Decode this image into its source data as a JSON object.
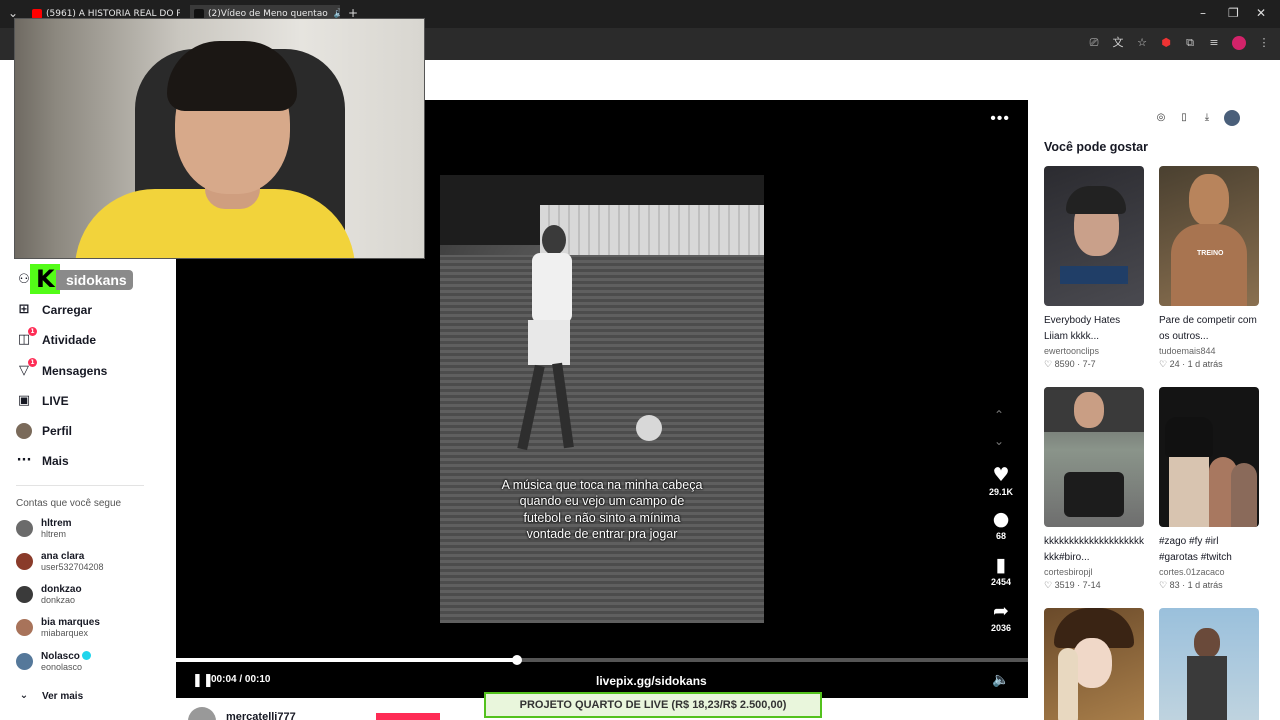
{
  "browser": {
    "tabs": [
      {
        "title": "(5961) A HISTORIA REAL DO P...",
        "favicon_color": "#ff0000"
      },
      {
        "title": "(2)Vídeo de Meno quentao",
        "favicon_color": "#111111"
      }
    ],
    "new_tab_symbol": "+",
    "window_controls": [
      "–",
      "❐",
      "✕"
    ]
  },
  "streamer_overlay": {
    "kick_logo_letter": "K",
    "kick_handle": "sidokans"
  },
  "sidebar": {
    "items": [
      {
        "label": "Carregar",
        "icon": "plus-square-icon",
        "glyph": "⊞"
      },
      {
        "label": "Atividade",
        "icon": "activity-icon",
        "glyph": "◫",
        "badge": "1"
      },
      {
        "label": "Mensagens",
        "icon": "messages-icon",
        "glyph": "▽",
        "badge": "1"
      },
      {
        "label": "LIVE",
        "icon": "live-icon",
        "glyph": "▣"
      },
      {
        "label": "Perfil",
        "icon": "profile-avatar",
        "glyph": ""
      },
      {
        "label": "Mais",
        "icon": "more-icon",
        "glyph": "···"
      }
    ],
    "following_heading": "Contas que você segue",
    "following": [
      {
        "name": "hltrem",
        "handle": "hltrem",
        "color": "#6b6b6b"
      },
      {
        "name": "ana clara",
        "handle": "user532704208",
        "color": "#8a3b2a"
      },
      {
        "name": "donkzao",
        "handle": "donkzao",
        "color": "#3a3a3a"
      },
      {
        "name": "bia marques",
        "handle": "miabarquex",
        "color": "#a8735a"
      },
      {
        "name": "Nolasco",
        "handle": "eonolasco",
        "color": "#55789a",
        "verified": true
      }
    ],
    "see_more": "Ver mais"
  },
  "player": {
    "more_glyph": "•••",
    "caption": "A música que toca na minha cabeça quando eu vejo um campo de futebol e não sinto a mínima vontade de entrar pra jogar",
    "likes": "29.1K",
    "comments": "68",
    "saves": "2454",
    "shares": "2036",
    "current_time": "00:04",
    "duration": "00:10",
    "time_display": "00:04 / 00:10",
    "progress_fraction": 0.4,
    "overlay_link": "livepix.gg/sidokans",
    "project_bar": "PROJETO QUARTO DE LIVE (R$ 18,23/R$ 2.500,00)",
    "comment_author": "mercatelli777"
  },
  "recommendations": {
    "title": "Você pode gostar",
    "items": [
      {
        "title": "Everybody Hates Liiam kkkk...",
        "author": "ewertoonclips",
        "likes": "8590",
        "date": "7-7",
        "bg": "#3b3a3c",
        "accent": "#2c5fa8"
      },
      {
        "title": "Pare de competir com os outros...",
        "author": "tudoemais844",
        "likes": "24",
        "date": "1 d atrás",
        "bg": "#7a6a4a",
        "accent": "#c8a070"
      },
      {
        "title": "kkkkkkkkkkkkkkkkkkkkkkk#biro...",
        "author": "cortesbiropjl",
        "likes": "3519",
        "date": "7-14",
        "bg": "#6e7a6a",
        "accent": "#2a2a2a"
      },
      {
        "title": "#zago #fy #irl #garotas #twitch",
        "author": "cortes.01zacaco",
        "likes": "83",
        "date": "1 d atrás",
        "bg": "#1a1a1a",
        "accent": "#8fb0c8"
      },
      {
        "title": "",
        "author": "",
        "likes": "",
        "date": "",
        "bg": "#b48850",
        "accent": "#e8d8c0"
      },
      {
        "title": "",
        "author": "",
        "likes": "",
        "date": "",
        "bg": "#8ab0c8",
        "accent": "#4a5a6a"
      }
    ]
  }
}
